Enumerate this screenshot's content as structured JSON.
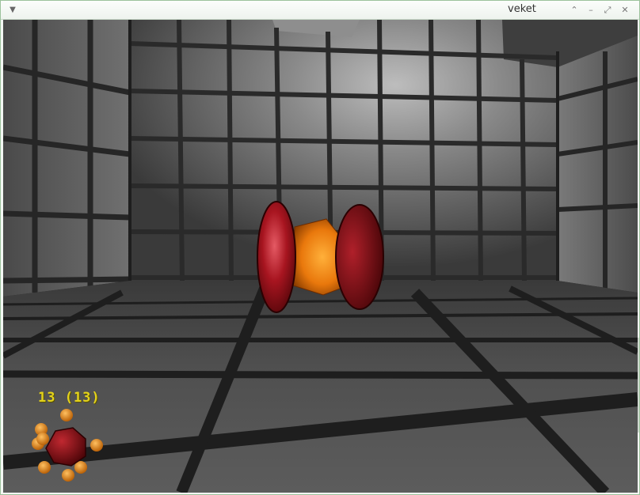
{
  "window": {
    "title": "veket",
    "controls": {
      "menu_icon": "chevron-down-icon",
      "maximize_icon": "chevron-up-icon",
      "minimize_icon": "minus-icon",
      "restore_icon": "resize-icon",
      "close_icon": "close-icon"
    }
  },
  "hud": {
    "counter_text": "13 (13)",
    "counter_color": "#e3d21c"
  },
  "colors": {
    "cylinder_red": "#8f0d12",
    "core_orange": "#f08a12",
    "pellet_orange": "#f0891a"
  }
}
